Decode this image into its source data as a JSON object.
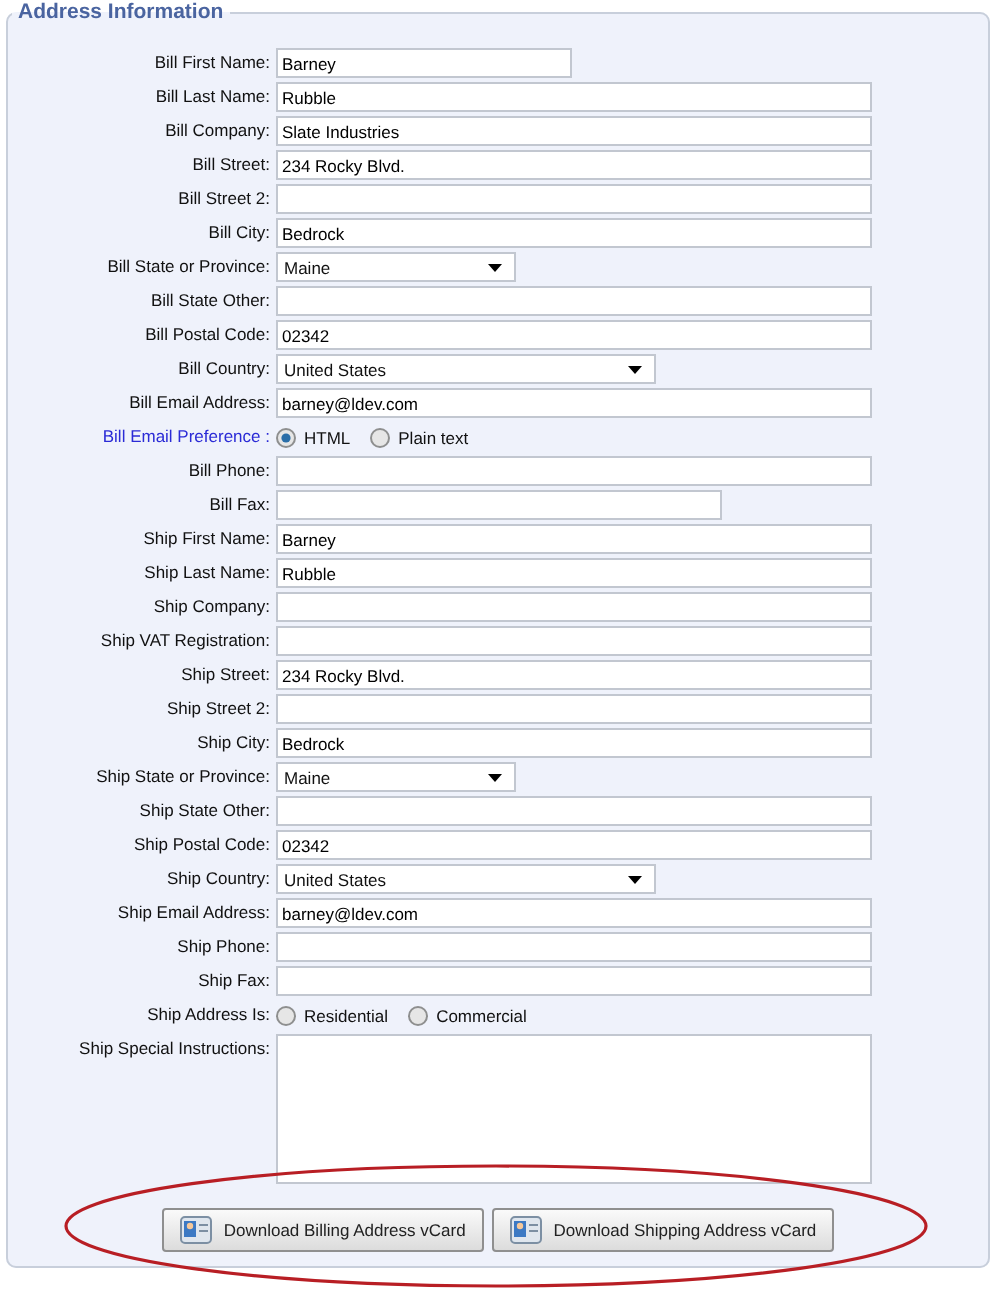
{
  "section": {
    "legend": "Address Information"
  },
  "rows": [
    {
      "label": "Bill First Name:",
      "kind": "text",
      "value": "Barney",
      "emphasized": false
    },
    {
      "label": "Bill Last Name:",
      "kind": "text",
      "value": "Rubble",
      "emphasized": false
    },
    {
      "label": "Bill Company:",
      "kind": "text",
      "value": "Slate Industries",
      "emphasized": false
    },
    {
      "label": "Bill Street:",
      "kind": "text",
      "value": "234 Rocky Blvd.",
      "emphasized": false
    },
    {
      "label": "Bill Street 2:",
      "kind": "text",
      "emphasized": false
    },
    {
      "label": "Bill City:",
      "kind": "text",
      "value": "Bedrock",
      "emphasized": false
    },
    {
      "label": "Bill State or Province:",
      "kind": "select",
      "value": "Maine",
      "emphasized": false
    },
    {
      "label": "Bill State Other:",
      "kind": "text",
      "emphasized": false
    },
    {
      "label": "Bill Postal Code:",
      "kind": "text",
      "value": "02342",
      "emphasized": false
    },
    {
      "label": "Bill Country:",
      "kind": "select",
      "value": "United States",
      "emphasized": false
    },
    {
      "label": "Bill Email Address:",
      "kind": "text",
      "value": "barney@ldev.com",
      "emphasized": false
    },
    {
      "label": "Bill Email Preference :",
      "kind": "radio",
      "emphasized": true,
      "options": [
        {
          "label": "HTML",
          "selected": true
        },
        {
          "label": "Plain text",
          "selected": false
        }
      ]
    },
    {
      "label": "Bill Phone:",
      "kind": "text",
      "emphasized": false
    },
    {
      "label": "Bill Fax:",
      "kind": "text",
      "emphasized": false
    },
    {
      "label": "Ship First Name:",
      "kind": "text",
      "value": "Barney",
      "emphasized": false
    },
    {
      "label": "Ship Last Name:",
      "kind": "text",
      "value": "Rubble",
      "emphasized": false
    },
    {
      "label": "Ship Company:",
      "kind": "text",
      "emphasized": false
    },
    {
      "label": "Ship VAT Registration:",
      "kind": "text",
      "emphasized": false
    },
    {
      "label": "Ship Street:",
      "kind": "text",
      "value": "234 Rocky Blvd.",
      "emphasized": false
    },
    {
      "label": "Ship Street 2:",
      "kind": "text",
      "emphasized": false
    },
    {
      "label": "Ship City:",
      "kind": "text",
      "value": "Bedrock",
      "emphasized": false
    },
    {
      "label": "Ship State or Province:",
      "kind": "select",
      "value": "Maine",
      "emphasized": false
    },
    {
      "label": "Ship State Other:",
      "kind": "text",
      "emphasized": false
    },
    {
      "label": "Ship Postal Code:",
      "kind": "text",
      "value": "02342",
      "emphasized": false
    },
    {
      "label": "Ship Country:",
      "kind": "select",
      "value": "United States",
      "emphasized": false
    },
    {
      "label": "Ship Email Address:",
      "kind": "text",
      "value": "barney@ldev.com",
      "emphasized": false
    },
    {
      "label": "Ship Phone:",
      "kind": "text",
      "emphasized": false
    },
    {
      "label": "Ship Fax:",
      "kind": "text",
      "emphasized": false
    },
    {
      "label": "Ship Address Is:",
      "kind": "radio",
      "emphasized": false,
      "options": [
        {
          "label": "Residential",
          "selected": false
        },
        {
          "label": "Commercial",
          "selected": false
        }
      ]
    },
    {
      "label": "Ship Special Instructions:",
      "kind": "textarea",
      "emphasized": false
    }
  ],
  "buttons": [
    {
      "label": "Download Billing Address vCard"
    },
    {
      "label": "Download Shipping Address vCard"
    }
  ]
}
